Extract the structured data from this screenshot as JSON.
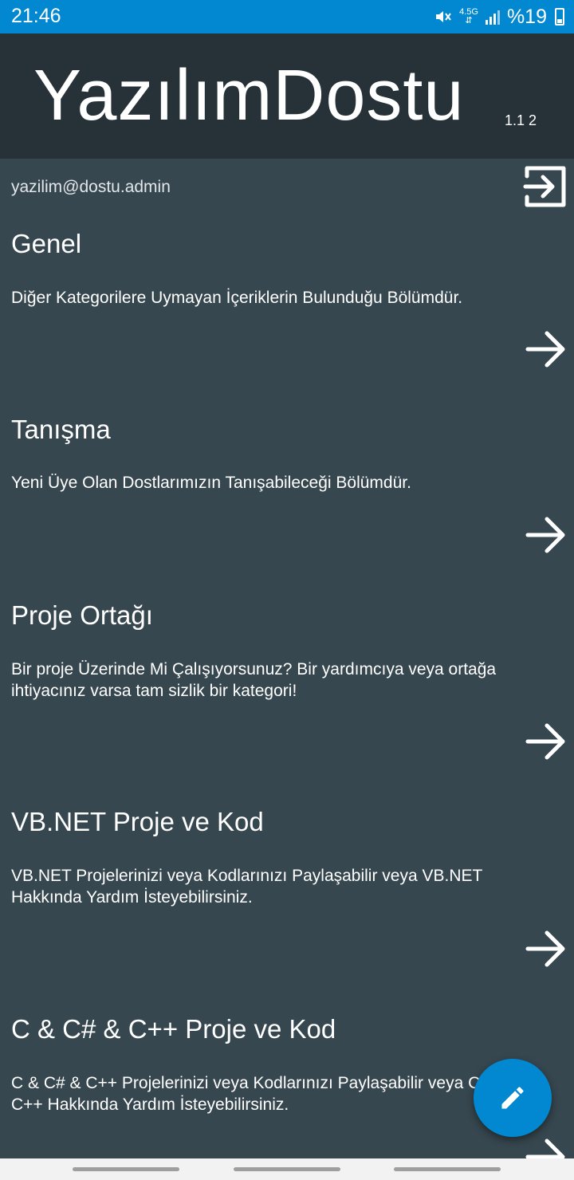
{
  "status_bar": {
    "time": "21:46",
    "network": "4.5G",
    "battery_text": "%19",
    "icons": [
      "mute-icon",
      "network-icon",
      "signal-icon",
      "battery-icon"
    ]
  },
  "header": {
    "title": "YazılımDostu",
    "version": "1.1 2"
  },
  "user": {
    "email": "yazilim@dostu.admin"
  },
  "categories": [
    {
      "title": "Genel",
      "description": "Diğer Kategorilere Uymayan İçeriklerin Bulunduğu Bölümdür."
    },
    {
      "title": "Tanışma",
      "description": "Yeni Üye Olan Dostlarımızın Tanışabileceği Bölümdür."
    },
    {
      "title": "Proje Ortağı",
      "description": "Bir proje Üzerinde Mi Çalışıyorsunuz? Bir yardımcıya veya ortağa ihtiyacınız varsa tam sizlik bir kategori!"
    },
    {
      "title": "VB.NET Proje ve Kod",
      "description": "VB.NET Projelerinizi veya Kodlarınızı Paylaşabilir veya VB.NET Hakkında Yardım İsteyebilirsiniz."
    },
    {
      "title": "C & C# & C++ Proje ve Kod",
      "description": "C & C# & C++ Projelerinizi veya Kodlarınızı Paylaşabilir veya C & C# & C++ Hakkında Yardım İsteyebilirsiniz."
    }
  ],
  "colors": {
    "status_bar": "#0288d1",
    "header": "#263238",
    "background": "#37474f",
    "fab": "#0288d1"
  }
}
